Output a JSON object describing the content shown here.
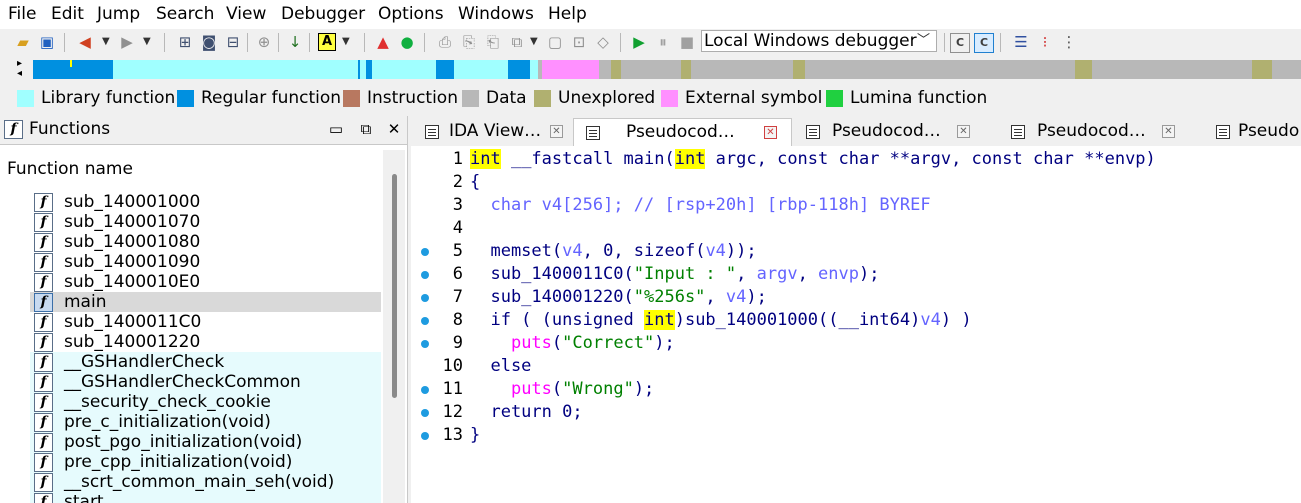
{
  "menu": [
    "File",
    "Edit",
    "Jump",
    "Search",
    "View",
    "Debugger",
    "Options",
    "Windows",
    "Help"
  ],
  "toolbar": {
    "debugger": "Local Windows debugger",
    "icons": [
      "open-folder",
      "save",
      "back-arrow",
      "forward-arrow",
      "graph",
      "font",
      "binary",
      "execute",
      "run",
      "pause",
      "stop"
    ]
  },
  "legend": [
    {
      "label": "Library function",
      "color": "#a0ffff"
    },
    {
      "label": "Regular function",
      "color": "#0090e0"
    },
    {
      "label": "Instruction",
      "color": "#b87860"
    },
    {
      "label": "Data",
      "color": "#b8b8b8"
    },
    {
      "label": "Unexplored",
      "color": "#b0b070"
    },
    {
      "label": "External symbol",
      "color": "#ff90ff"
    },
    {
      "label": "Lumina function",
      "color": "#20d040"
    }
  ],
  "functions": {
    "title": "Functions",
    "column": "Function name",
    "items": [
      {
        "name": "sub_140001000",
        "type": "regular"
      },
      {
        "name": "sub_140001070",
        "type": "regular"
      },
      {
        "name": "sub_140001080",
        "type": "regular"
      },
      {
        "name": "sub_140001090",
        "type": "regular"
      },
      {
        "name": "sub_1400010E0",
        "type": "regular"
      },
      {
        "name": "main",
        "type": "regular",
        "selected": true
      },
      {
        "name": "sub_1400011C0",
        "type": "regular"
      },
      {
        "name": "sub_140001220",
        "type": "regular"
      },
      {
        "name": "__GSHandlerCheck",
        "type": "library"
      },
      {
        "name": "__GSHandlerCheckCommon",
        "type": "library"
      },
      {
        "name": "__security_check_cookie",
        "type": "library"
      },
      {
        "name": "pre_c_initialization(void)",
        "type": "library"
      },
      {
        "name": "post_pgo_initialization(void)",
        "type": "library"
      },
      {
        "name": "pre_cpp_initialization(void)",
        "type": "library"
      },
      {
        "name": "__scrt_common_main_seh(void)",
        "type": "library"
      },
      {
        "name": "start",
        "type": "library"
      }
    ]
  },
  "tabs": [
    {
      "label": "IDA View…",
      "active": false
    },
    {
      "label": "Pseudocod…",
      "active": true
    },
    {
      "label": "Pseudocod…",
      "active": false
    },
    {
      "label": "Pseudocod…",
      "active": false
    },
    {
      "label": "Pseudo",
      "active": false
    }
  ],
  "code": [
    {
      "n": "1",
      "dot": false,
      "html": "<span class=\"hl\">int</span> __fastcall main(<span class=\"hl\">int</span> argc, const char **argv, const char **envp)"
    },
    {
      "n": "2",
      "dot": false,
      "html": "{"
    },
    {
      "n": "3",
      "dot": false,
      "html": "  <span class=\"cm\">char v4[256]; // [rsp+20h] [rbp-118h] BYREF</span>"
    },
    {
      "n": "4",
      "dot": false,
      "html": ""
    },
    {
      "n": "5",
      "dot": true,
      "html": "  memset(<span class=\"cm\">v4</span>, 0, sizeof(<span class=\"cm\">v4</span>));"
    },
    {
      "n": "6",
      "dot": true,
      "html": "  sub_1400011C0(<span class=\"str\">\"Input : \"</span>, <span class=\"cm\">argv</span>, <span class=\"cm\">envp</span>);"
    },
    {
      "n": "7",
      "dot": true,
      "html": "  sub_140001220(<span class=\"str\">\"%256s\"</span>, <span class=\"cm\">v4</span>);"
    },
    {
      "n": "8",
      "dot": true,
      "html": "  if ( (unsigned <span class=\"hl\">int</span>)sub_140001000((__int64)<span class=\"cm\">v4</span>) )"
    },
    {
      "n": "9",
      "dot": true,
      "html": "    <span class=\"lib\">puts</span>(<span class=\"str\">\"Correct\"</span>);"
    },
    {
      "n": "10",
      "dot": false,
      "html": "  else"
    },
    {
      "n": "11",
      "dot": true,
      "html": "    <span class=\"lib\">puts</span>(<span class=\"str\">\"Wrong\"</span>);"
    },
    {
      "n": "12",
      "dot": true,
      "html": "  return 0;"
    },
    {
      "n": "13",
      "dot": true,
      "html": "}"
    }
  ]
}
